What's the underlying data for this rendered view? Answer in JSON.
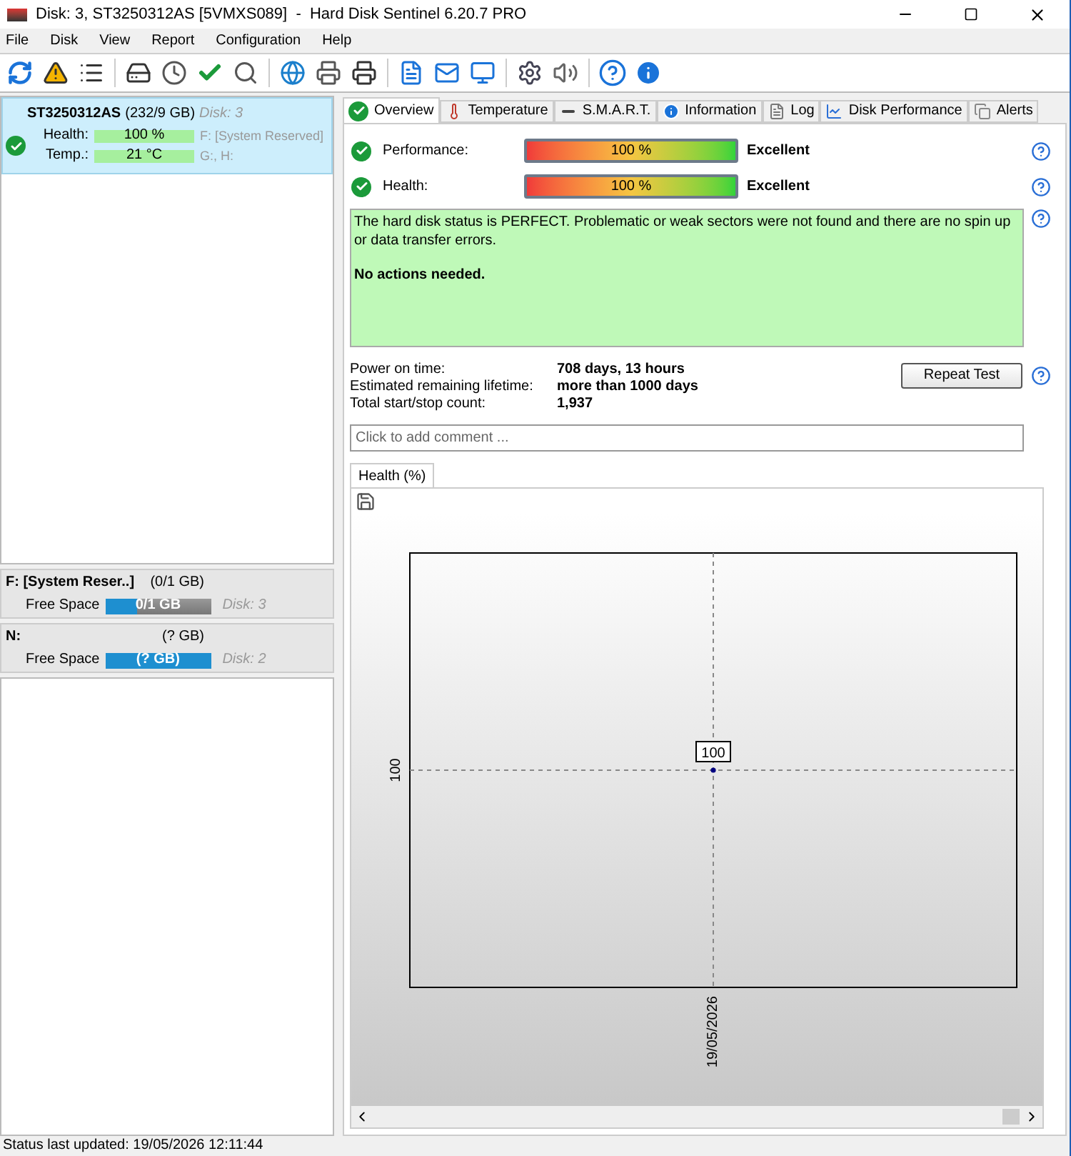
{
  "window": {
    "title": "Disk: 3, ST3250312AS [5VMXS089]  -  Hard Disk Sentinel 6.20.7 PRO"
  },
  "menu": [
    "File",
    "Disk",
    "View",
    "Report",
    "Configuration",
    "Help"
  ],
  "disks": [
    {
      "name": "ST3250312AS",
      "size": "(232/9 GB)",
      "disk": "Disk: 3",
      "selected": true,
      "health": {
        "label": "Health:",
        "value": "100 %",
        "level": 1
      },
      "temp": {
        "label": "Temp.:",
        "value": "21 °C",
        "level": 1
      },
      "volumes_1": "F: [System Reserved]",
      "volumes_2": "G:, H:"
    }
  ],
  "partitions": [
    {
      "name": "F: [System Reser..]",
      "size": "(0/1 GB)",
      "label": "Free Space",
      "value": "0/1 GB",
      "level": 0.3,
      "disk": "Disk: 3"
    },
    {
      "name": "N:",
      "size": "(? GB)",
      "label": "Free Space",
      "value": "(? GB)",
      "level": 1,
      "disk": "Disk: 2"
    }
  ],
  "tabs": [
    {
      "label": "Overview",
      "selected": true
    },
    {
      "label": "Temperature",
      "selected": false
    },
    {
      "label": "S.M.A.R.T.",
      "selected": false
    },
    {
      "label": "Information",
      "selected": false
    },
    {
      "label": "Log",
      "selected": false
    },
    {
      "label": "Disk Performance",
      "selected": false
    },
    {
      "label": "Alerts",
      "selected": false
    }
  ],
  "metrics": [
    {
      "label": "Performance:",
      "value": "100 %",
      "level": 1,
      "rating": "Excellent"
    },
    {
      "label": "Health:",
      "value": "100 %",
      "level": 1,
      "rating": "Excellent"
    }
  ],
  "status_box": {
    "text": "The hard disk status is PERFECT. Problematic or weak sectors were not found and there are no spin up or data transfer errors.",
    "action": "No actions needed."
  },
  "info": [
    {
      "label": "Power on time:",
      "value": "708 days, 13 hours"
    },
    {
      "label": "Estimated remaining lifetime:",
      "value": "more than 1000 days"
    },
    {
      "label": "Total start/stop count:",
      "value": "1,937"
    }
  ],
  "repeat_button": "Repeat Test",
  "comment": {
    "placeholder": "Click to add comment ..."
  },
  "chart": {
    "tab": "Health (%)",
    "y_tick": "100",
    "x_tick": "19/05/2026",
    "point_label": "100"
  },
  "status_bar": "Status last updated: 19/05/2026 12:11:44"
}
